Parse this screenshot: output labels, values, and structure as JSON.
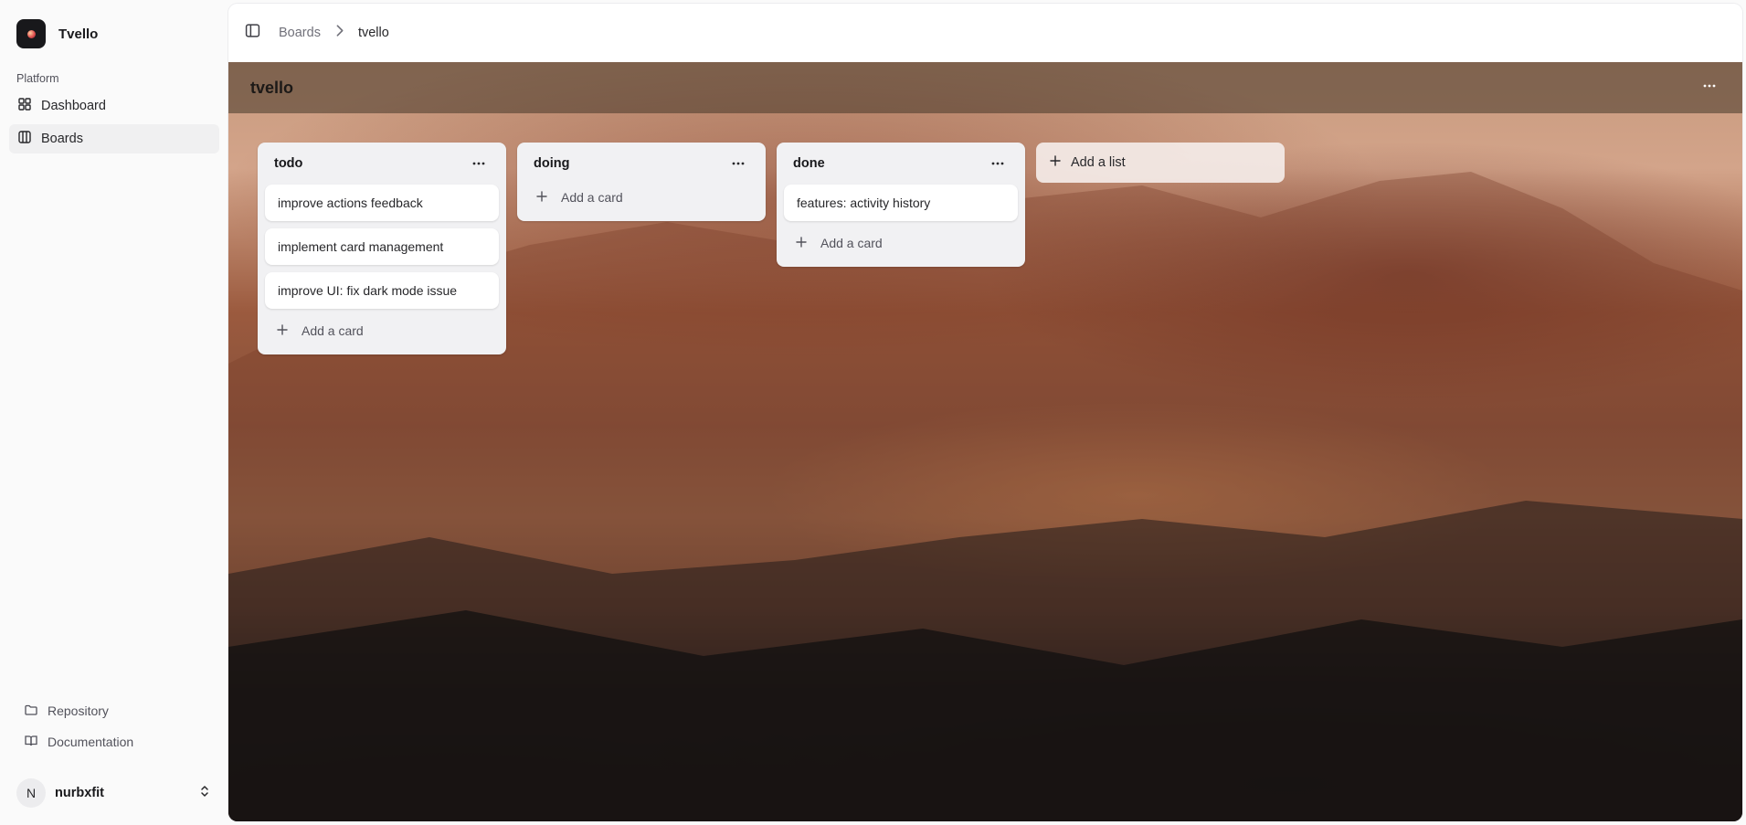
{
  "app": {
    "name": "Tvello"
  },
  "sidebar": {
    "section_label": "Platform",
    "items": [
      {
        "label": "Dashboard",
        "icon": "dashboard-icon",
        "active": false
      },
      {
        "label": "Boards",
        "icon": "board-icon",
        "active": true
      }
    ],
    "footer_links": [
      {
        "label": "Repository",
        "icon": "folder-icon"
      },
      {
        "label": "Documentation",
        "icon": "book-icon"
      }
    ],
    "user": {
      "initial": "N",
      "name": "nurbxfit"
    }
  },
  "breadcrumb": {
    "parent": "Boards",
    "current": "tvello"
  },
  "board": {
    "title": "tvello",
    "lists": [
      {
        "title": "todo",
        "cards": [
          "improve actions feedback",
          "implement card management",
          "improve UI: fix dark mode issue"
        ],
        "add_label": "Add a card"
      },
      {
        "title": "doing",
        "cards": [],
        "add_label": "Add a card"
      },
      {
        "title": "done",
        "cards": [
          "features: activity history"
        ],
        "add_label": "Add a card"
      }
    ],
    "add_list_label": "Add a list"
  },
  "colors": {
    "sidebar_bg": "#fafafa",
    "list_bg": "#f1f1f3",
    "brand_bg": "#18181b"
  }
}
